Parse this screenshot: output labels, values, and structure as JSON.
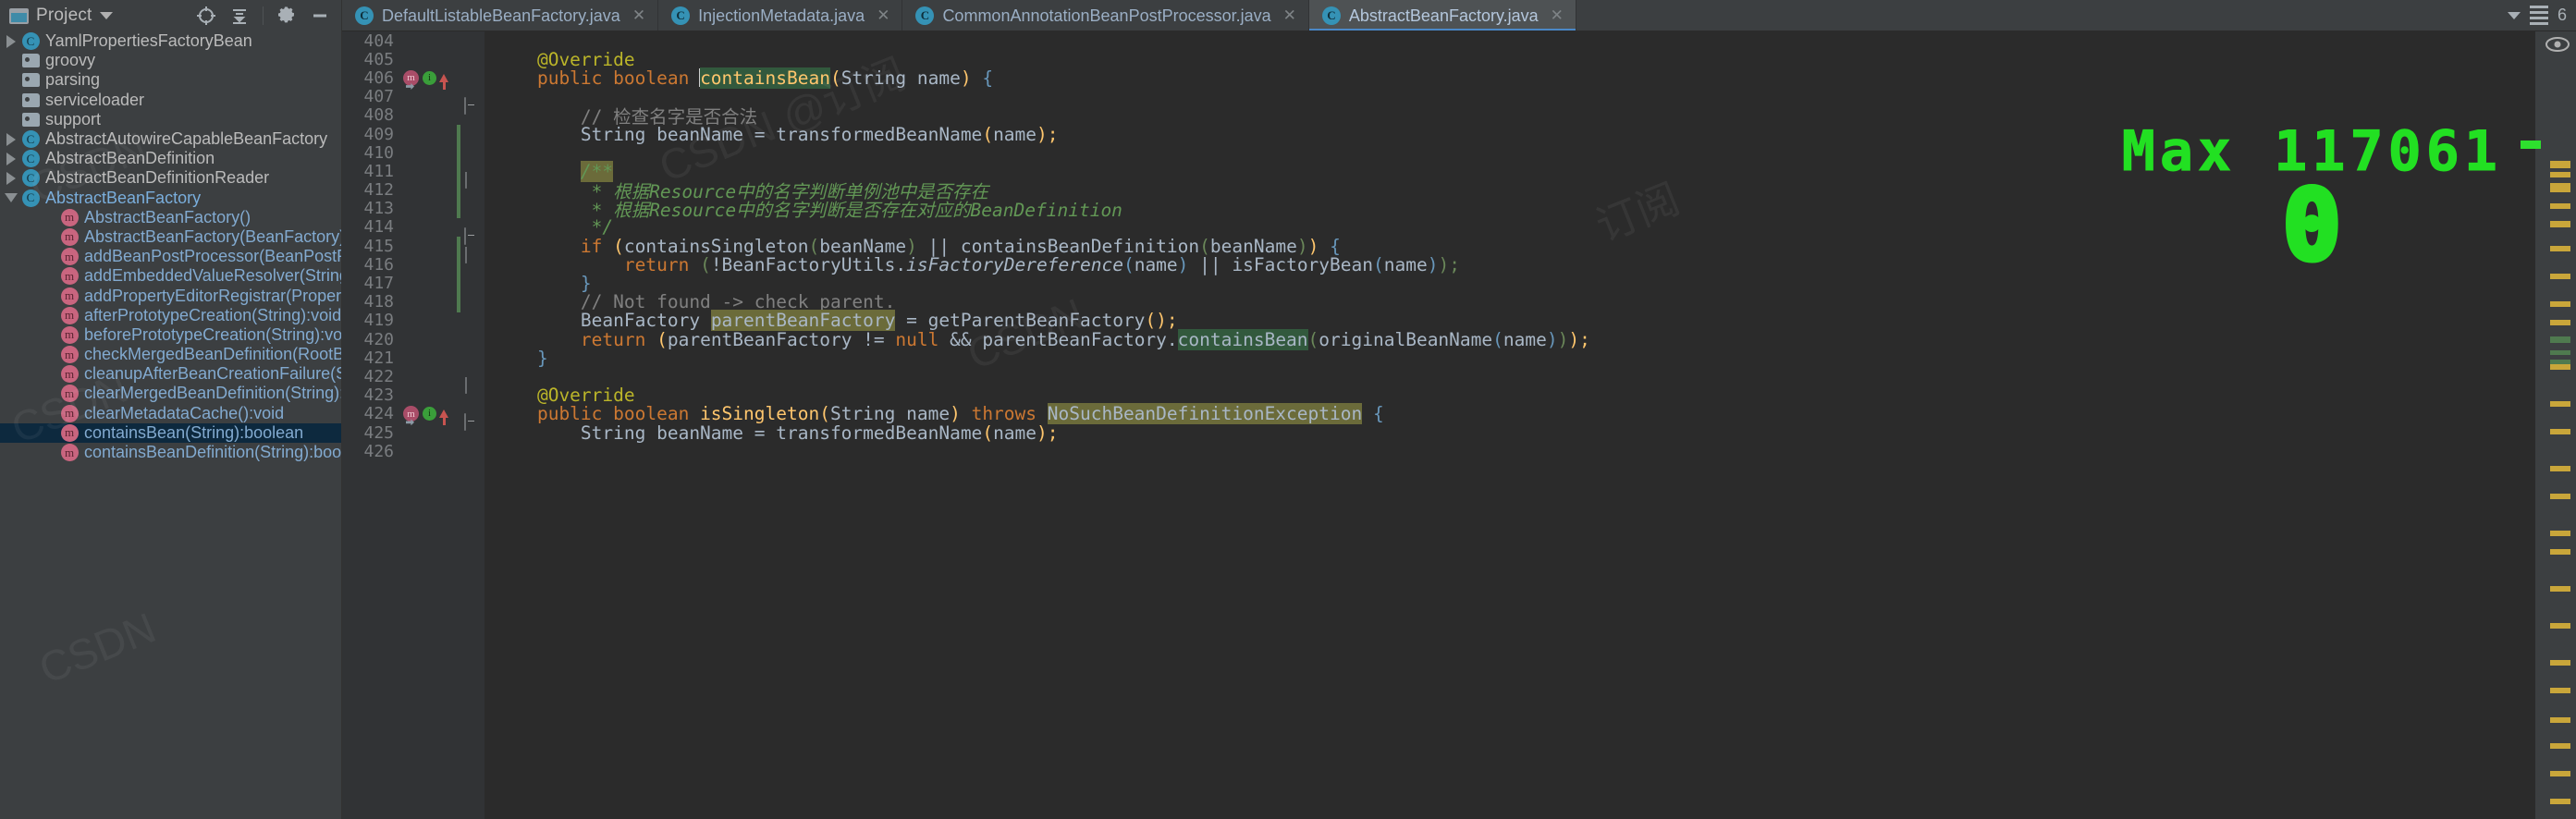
{
  "window": {
    "project_panel": {
      "title": "Project",
      "icons": [
        "project-window-icon",
        "chevron-down-icon",
        "locate-icon",
        "collapse-all-icon",
        "settings-gear-icon",
        "minimize-icon"
      ]
    }
  },
  "tabs": [
    {
      "label": "DefaultListableBeanFactory.java",
      "icon": "java-class-icon",
      "active": false,
      "closable": true
    },
    {
      "label": "InjectionMetadata.java",
      "icon": "java-class-icon",
      "active": false,
      "closable": true
    },
    {
      "label": "CommonAnnotationBeanPostProcessor.java",
      "icon": "java-class-icon",
      "active": false,
      "closable": true
    },
    {
      "label": "AbstractBeanFactory.java",
      "icon": "java-class-icon",
      "active": true,
      "closable": true
    }
  ],
  "tree": [
    {
      "label": "YamlPropertiesFactoryBean",
      "kind": "class",
      "expand": "collapsed",
      "indent": 0,
      "selected": false
    },
    {
      "label": "groovy",
      "kind": "folder",
      "expand": "none",
      "indent": 0,
      "selected": false
    },
    {
      "label": "parsing",
      "kind": "folder",
      "expand": "none",
      "indent": 0,
      "selected": false
    },
    {
      "label": "serviceloader",
      "kind": "folder",
      "expand": "none",
      "indent": 0,
      "selected": false
    },
    {
      "label": "support",
      "kind": "folder",
      "expand": "none",
      "indent": 0,
      "selected": false
    },
    {
      "label": "AbstractAutowireCapableBeanFactory",
      "kind": "class",
      "expand": "collapsed",
      "indent": 0,
      "selected": false
    },
    {
      "label": "AbstractBeanDefinition",
      "kind": "class",
      "expand": "collapsed",
      "indent": 0,
      "selected": false
    },
    {
      "label": "AbstractBeanDefinitionReader",
      "kind": "class",
      "expand": "collapsed",
      "indent": 0,
      "selected": false
    },
    {
      "label": "AbstractBeanFactory",
      "kind": "class-active",
      "expand": "expanded",
      "indent": 0,
      "selected": false
    },
    {
      "label": "AbstractBeanFactory()",
      "kind": "method",
      "expand": "none",
      "indent": 2,
      "selected": false
    },
    {
      "label": "AbstractBeanFactory(BeanFactory)",
      "kind": "method",
      "expand": "none",
      "indent": 2,
      "selected": false
    },
    {
      "label": "addBeanPostProcessor(BeanPostProcessor)",
      "kind": "method",
      "expand": "none",
      "indent": 2,
      "selected": false
    },
    {
      "label": "addEmbeddedValueResolver(StringValueResolver)",
      "kind": "method",
      "expand": "none",
      "indent": 2,
      "selected": false
    },
    {
      "label": "addPropertyEditorRegistrar(PropertyEditorRegistrar)",
      "kind": "method",
      "expand": "none",
      "indent": 2,
      "selected": false
    },
    {
      "label": "afterPrototypeCreation(String):void",
      "kind": "method",
      "expand": "none",
      "indent": 2,
      "selected": false
    },
    {
      "label": "beforePrototypeCreation(String):void",
      "kind": "method",
      "expand": "none",
      "indent": 2,
      "selected": false
    },
    {
      "label": "checkMergedBeanDefinition(RootBeanDefinition",
      "kind": "method",
      "expand": "none",
      "indent": 2,
      "selected": false
    },
    {
      "label": "cleanupAfterBeanCreationFailure(String):void",
      "kind": "method",
      "expand": "none",
      "indent": 2,
      "selected": false
    },
    {
      "label": "clearMergedBeanDefinition(String):void",
      "kind": "method",
      "expand": "none",
      "indent": 2,
      "selected": false
    },
    {
      "label": "clearMetadataCache():void",
      "kind": "method",
      "expand": "none",
      "indent": 2,
      "selected": false
    },
    {
      "label": "containsBean(String):boolean",
      "kind": "method",
      "expand": "none",
      "indent": 2,
      "selected": true
    },
    {
      "label": "containsBeanDefinition(String):boolean",
      "kind": "method",
      "expand": "none",
      "indent": 2,
      "selected": false
    }
  ],
  "editor": {
    "first_line": 404,
    "lines": [
      {
        "num": "404",
        "gutter": null
      },
      {
        "num": "405",
        "gutter": null
      },
      {
        "num": "406",
        "gutter": "override-run"
      },
      {
        "num": "407",
        "gutter": null
      },
      {
        "num": "408",
        "gutter": null
      },
      {
        "num": "409",
        "gutter": null
      },
      {
        "num": "410",
        "gutter": null
      },
      {
        "num": "411",
        "gutter": null
      },
      {
        "num": "412",
        "gutter": null
      },
      {
        "num": "413",
        "gutter": null
      },
      {
        "num": "414",
        "gutter": null
      },
      {
        "num": "415",
        "gutter": null
      },
      {
        "num": "416",
        "gutter": null
      },
      {
        "num": "417",
        "gutter": null
      },
      {
        "num": "418",
        "gutter": null
      },
      {
        "num": "419",
        "gutter": null
      },
      {
        "num": "420",
        "gutter": null
      },
      {
        "num": "421",
        "gutter": null
      },
      {
        "num": "422",
        "gutter": null
      },
      {
        "num": "423",
        "gutter": null
      },
      {
        "num": "424",
        "gutter": "override-run"
      },
      {
        "num": "425",
        "gutter": null
      },
      {
        "num": "426",
        "gutter": null
      }
    ],
    "code_text": [
      "",
      "    @Override",
      "    public boolean containsBean(String name) {",
      "",
      "        // 检查名字是否合法",
      "        String beanName = transformedBeanName(name);",
      "",
      "        /**",
      "         * 根据Resource中的名字判断单例池中是否存在",
      "         * 根据Resource中的名字判断是否存在对应的BeanDefinition",
      "         */",
      "        if (containsSingleton(beanName) || containsBeanDefinition(beanName)) {",
      "            return (!BeanFactoryUtils.isFactoryDereference(name) || isFactoryBean(name));",
      "        }",
      "        // Not found -> check parent.",
      "        BeanFactory parentBeanFactory = getParentBeanFactory();",
      "        return (parentBeanFactory != null && parentBeanFactory.containsBean(originalBeanName(name)));",
      "    }",
      "",
      "    @Override",
      "    public boolean isSingleton(String name) throws NoSuchBeanDefinitionException {",
      "        String beanName = transformedBeanName(name);",
      ""
    ],
    "highlights": {
      "search_term": "containsBean",
      "identifier_under_caret": "parentBeanFactory",
      "exception_type": "NoSuchBeanDefinitionException"
    }
  },
  "overlay": {
    "label": "Max  117061",
    "big_value": "0"
  },
  "colors": {
    "editor_bg": "#2b2b2b",
    "panel_bg": "#3c3f41",
    "gutter_bg": "#313335",
    "selection_bg": "#0d293e",
    "accent_blue": "#4a88c7",
    "keyword_orange": "#cc7832",
    "annotation_yellow": "#bbb529",
    "javadoc_green": "#629755",
    "comment_gray": "#808080",
    "method_yellow": "#ffc66d",
    "text_default": "#a9b7c6",
    "overlay_green": "#22e022",
    "search_highlight": "#32593d",
    "caret_highlight": "#6b6b3a",
    "marker_yellow": "#c9a63a"
  }
}
